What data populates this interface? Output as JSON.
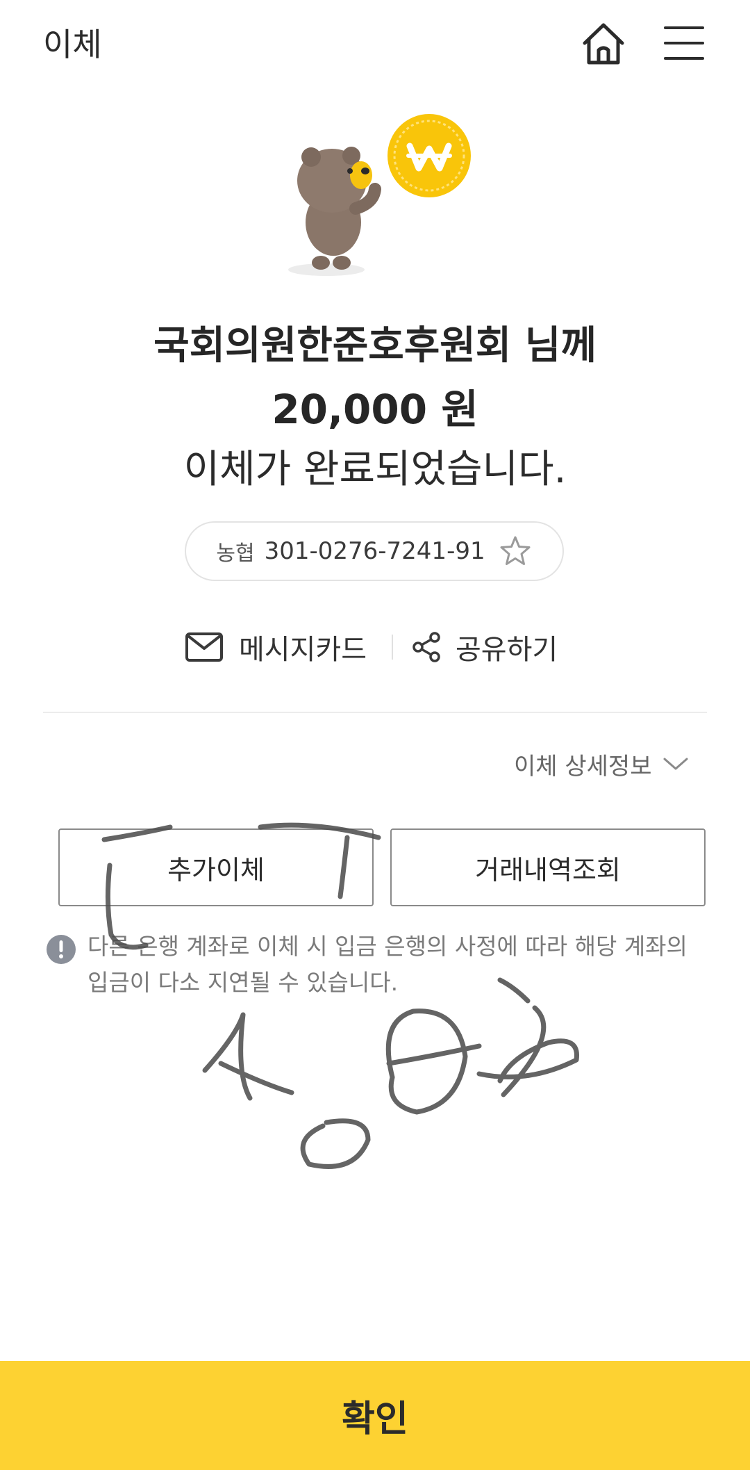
{
  "header": {
    "title": "이체"
  },
  "result": {
    "recipient_line": "국회의원한준호후원회 님께",
    "amount_line": "20,000 원",
    "status_line": "이체가 완료되었습니다."
  },
  "account": {
    "bank": "농협",
    "number": "301-0276-7241-91"
  },
  "actions": {
    "message_card": "메시지카드",
    "share": "공유하기"
  },
  "detail": {
    "toggle_label": "이체 상세정보"
  },
  "buttons": {
    "additional_transfer": "추가이체",
    "transaction_history": "거래내역조회"
  },
  "notice": {
    "text": "다른 은행 계좌로 이체 시 입금 은행의 사정에 따라 해당 계좌의 입금이 다소 지연될 수 있습니다."
  },
  "confirm": {
    "label": "확인"
  },
  "colors": {
    "accent_yellow": "#fdd232",
    "coin": "#f9c50a"
  },
  "icons": [
    "home-icon",
    "menu-icon",
    "star-icon",
    "mail-icon",
    "share-icon",
    "chevron-down-icon",
    "info-icon"
  ]
}
